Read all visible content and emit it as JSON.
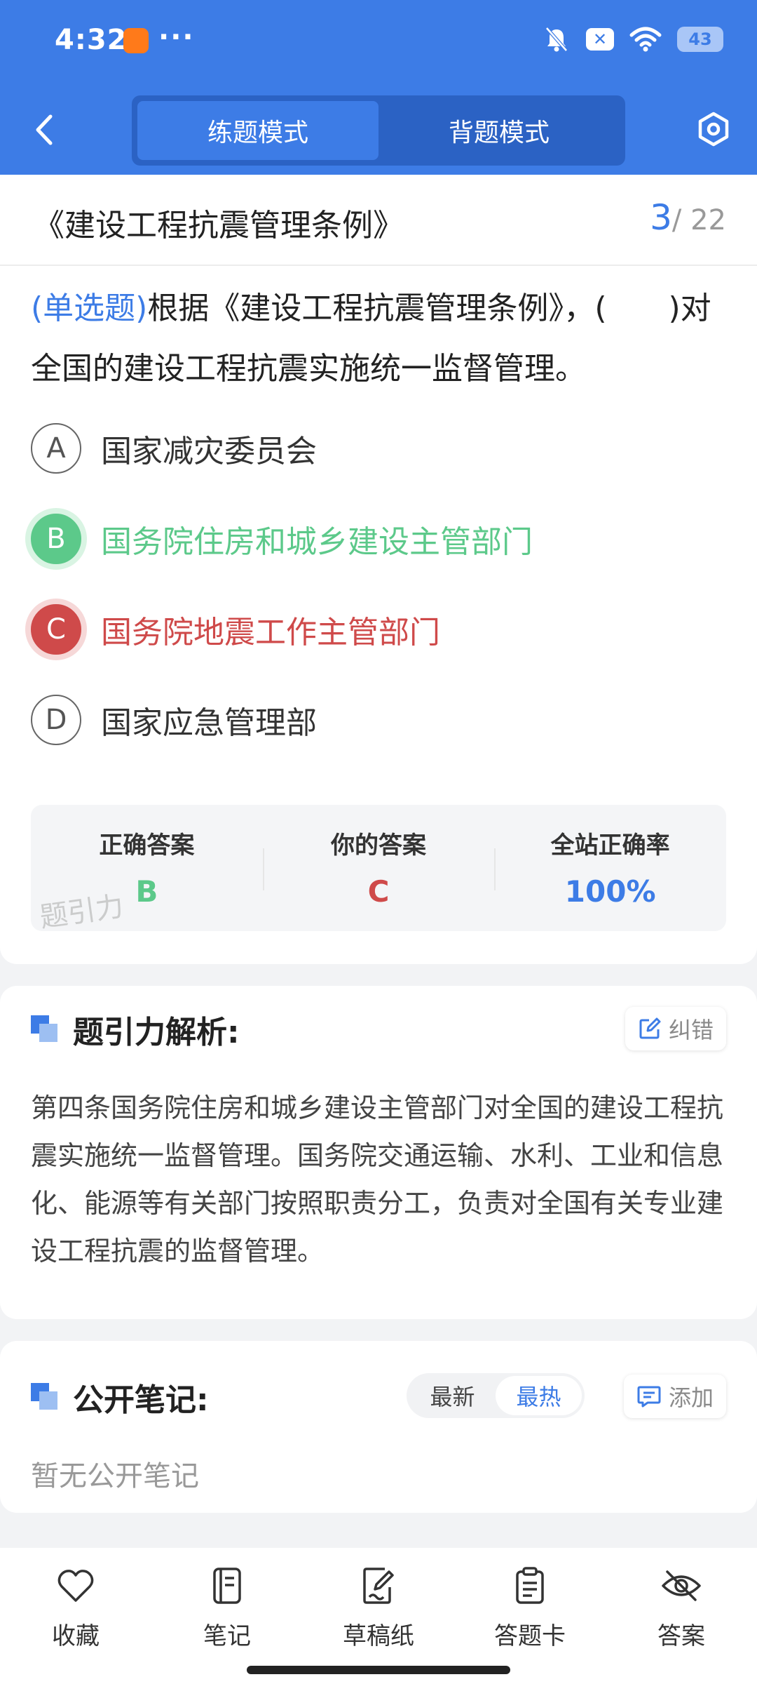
{
  "status_bar": {
    "time": "4:32",
    "dots": "···",
    "battery": "43"
  },
  "header": {
    "modes": [
      "练题模式",
      "背题模式"
    ],
    "active_mode": 0
  },
  "paper": {
    "title": "《建设工程抗震管理条例》",
    "current": "3",
    "total": "/ 22"
  },
  "question": {
    "type_label": "(单选题)",
    "text": "根据《建设工程抗震管理条例》，(　　)对全国的建设工程抗震实施统一监督管理。",
    "options": [
      {
        "letter": "A",
        "text": "国家减灾委员会",
        "state": "normal"
      },
      {
        "letter": "B",
        "text": "国务院住房和城乡建设主管部门",
        "state": "correct"
      },
      {
        "letter": "C",
        "text": "国务院地震工作主管部门",
        "state": "wrong"
      },
      {
        "letter": "D",
        "text": "国家应急管理部",
        "state": "normal"
      }
    ]
  },
  "answer_box": {
    "correct_label": "正确答案",
    "correct_value": "B",
    "yours_label": "你的答案",
    "yours_value": "C",
    "rate_label": "全站正确率",
    "rate_value": "100%",
    "watermark": "题引力"
  },
  "analysis": {
    "title": "题引力解析:",
    "report_label": "纠错",
    "text": "第四条国务院住房和城乡建设主管部门对全国的建设工程抗震实施统一监督管理。国务院交通运输、水利、工业和信息化、能源等有关部门按照职责分工，负责对全国有关专业建设工程抗震的监督管理。"
  },
  "notes": {
    "title": "公开笔记:",
    "sort_options": [
      "最新",
      "最热"
    ],
    "add_label": "添加",
    "empty_text": "暂无公开笔记"
  },
  "bottom_tabs": [
    {
      "label": "收藏",
      "icon": "heart-icon"
    },
    {
      "label": "笔记",
      "icon": "notebook-icon"
    },
    {
      "label": "草稿纸",
      "icon": "draft-paper-icon"
    },
    {
      "label": "答题卡",
      "icon": "answer-card-icon"
    },
    {
      "label": "答案",
      "icon": "eye-off-icon"
    }
  ],
  "colors": {
    "primary": "#3d7ce6",
    "correct": "#5cc98a",
    "wrong": "#cf4a4a"
  }
}
